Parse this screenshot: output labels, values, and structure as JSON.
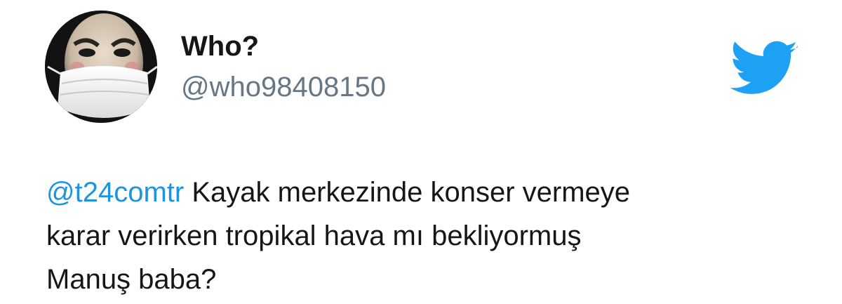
{
  "author": {
    "display_name": "Who?",
    "handle": "@who98408150",
    "avatar_icon": "masked-face-avatar"
  },
  "brand": {
    "icon": "twitter-bird-icon",
    "color": "#1da1f2"
  },
  "tweet": {
    "mention": "@t24comtr",
    "line1_rest": " Kayak merkezinde konser vermeye",
    "line2": "karar verirken tropikal hava mı bekliyormuş",
    "line3": "Manuş baba?"
  },
  "colors": {
    "mention": "#1b95e0",
    "handle": "#657786",
    "text": "#14171a"
  }
}
